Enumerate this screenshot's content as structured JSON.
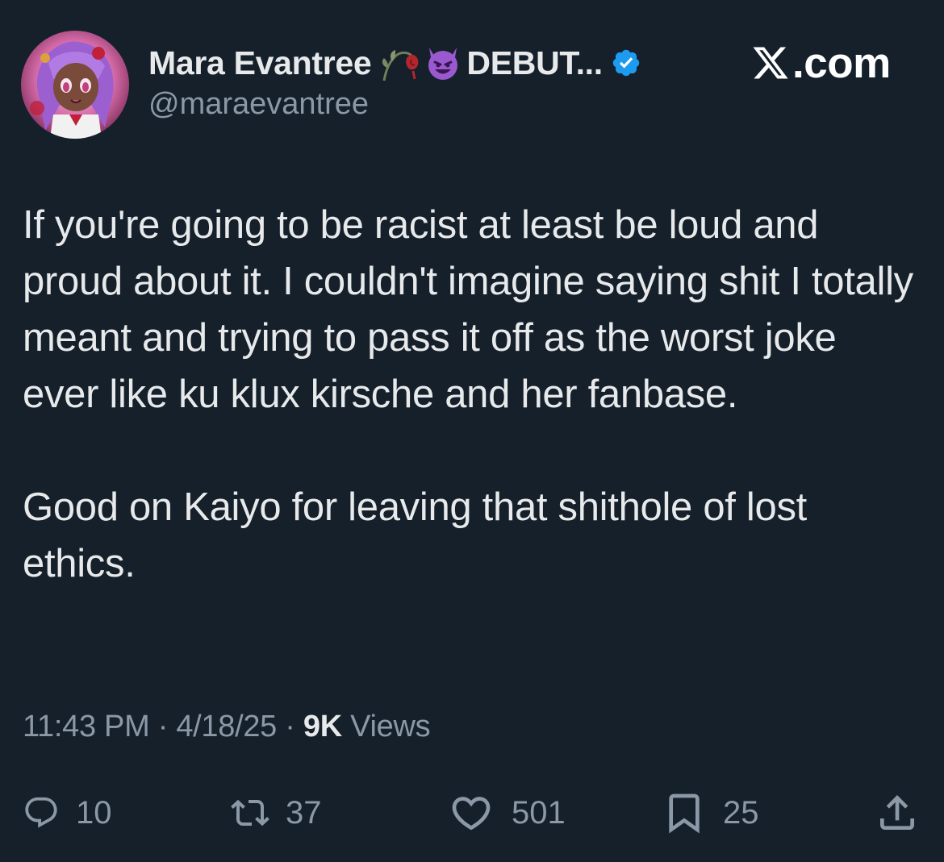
{
  "author": {
    "display_name": "Mara Evantree",
    "name_emojis": [
      "wilted-rose-icon",
      "smiling-devil-icon"
    ],
    "name_suffix": "DEBUT...",
    "verified": true,
    "handle": "@maraevantree"
  },
  "watermark": {
    "logo": "x-logo-icon",
    "text": ".com"
  },
  "tweet": {
    "paragraph_1": "If you're going to be racist at least be loud and proud about it. I couldn't imagine saying shit I totally meant and trying to pass it off as the worst joke ever like ku klux kirsche and her fanbase.",
    "paragraph_2": "Good on Kaiyo for leaving that shithole of lost ethics."
  },
  "meta": {
    "time": "11:43 PM",
    "separator": "·",
    "date": "4/18/25",
    "views_count": "9K",
    "views_label": "Views"
  },
  "actions": {
    "replies": "10",
    "reposts": "37",
    "likes": "501",
    "bookmarks": "25"
  },
  "colors": {
    "background": "#15202b",
    "primary_text": "#e7e9ea",
    "secondary_text": "#8b98a5",
    "verified_blue": "#1d9bf0"
  }
}
